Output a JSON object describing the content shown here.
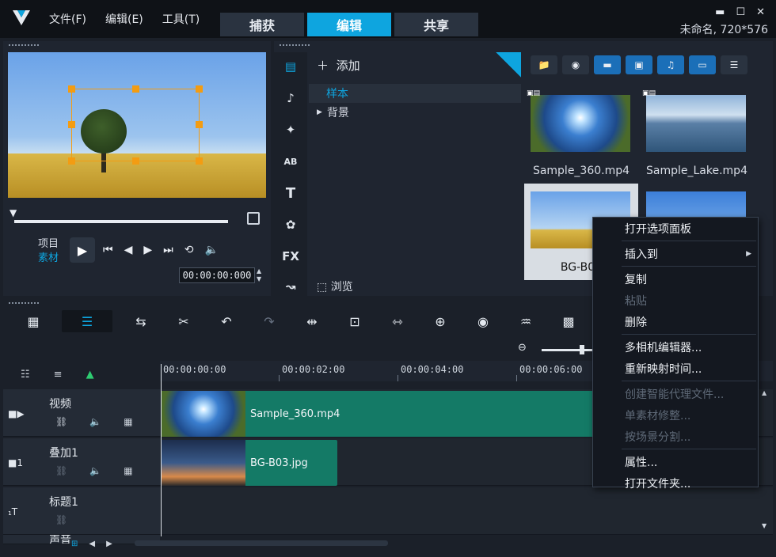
{
  "menu": {
    "file": "文件(F)",
    "edit": "编辑(E)",
    "tools": "工具(T)"
  },
  "stage_tabs": [
    {
      "label": "捕获",
      "active": false
    },
    {
      "label": "编辑",
      "active": true
    },
    {
      "label": "共享",
      "active": false
    }
  ],
  "window": {
    "project_info": "未命名, 720*576",
    "minimize": "▬",
    "maximize": "☐",
    "close": "✕"
  },
  "preview": {
    "mode_project": "项目",
    "mode_clip": "素材",
    "timecode": "00:00:00:000"
  },
  "library": {
    "add_label": "添加",
    "folders": [
      {
        "label": "样本",
        "selected": true,
        "expandable": false
      },
      {
        "label": "背景",
        "selected": false,
        "expandable": true
      }
    ],
    "browse_label": "浏览",
    "thumbnails": [
      {
        "name": "Sample_360.mp4",
        "selected": false
      },
      {
        "name": "Sample_Lake.mp4",
        "selected": false
      },
      {
        "name": "BG-B01",
        "selected": true
      },
      {
        "name": "",
        "selected": false
      }
    ]
  },
  "rail": {
    "fx": "FX",
    "text": "T",
    "ab": "AB"
  },
  "timeline": {
    "ruler": [
      "00:00:00:00",
      "00:00:02:00",
      "00:00:04:00",
      "00:00:06:00"
    ],
    "tracks": [
      {
        "name": "视频",
        "clip": "Sample_360.mp4"
      },
      {
        "name": "叠加1",
        "clip": "BG-B03.jpg"
      },
      {
        "name": "标题1",
        "clip": ""
      },
      {
        "name": "声音",
        "clip": ""
      }
    ]
  },
  "context_menu": {
    "items": [
      {
        "label": "打开选项面板",
        "disabled": false,
        "submenu": false,
        "sep_after": true
      },
      {
        "label": "插入到",
        "disabled": false,
        "submenu": true,
        "sep_after": true
      },
      {
        "label": "复制",
        "disabled": false,
        "submenu": false,
        "sep_after": false
      },
      {
        "label": "粘贴",
        "disabled": true,
        "submenu": false,
        "sep_after": false
      },
      {
        "label": "删除",
        "disabled": false,
        "submenu": false,
        "sep_after": true
      },
      {
        "label": "多相机编辑器...",
        "disabled": false,
        "submenu": false,
        "sep_after": false
      },
      {
        "label": "重新映射时间...",
        "disabled": false,
        "submenu": false,
        "sep_after": true
      },
      {
        "label": "创建智能代理文件...",
        "disabled": true,
        "submenu": false,
        "sep_after": false
      },
      {
        "label": "单素材修整...",
        "disabled": true,
        "submenu": false,
        "sep_after": false
      },
      {
        "label": "按场景分割...",
        "disabled": true,
        "submenu": false,
        "sep_after": true
      },
      {
        "label": "属性...",
        "disabled": false,
        "submenu": false,
        "sep_after": false
      },
      {
        "label": "打开文件夹...",
        "disabled": false,
        "submenu": false,
        "sep_after": false
      }
    ]
  },
  "colors": {
    "accent": "#0ea5df",
    "clip": "#147a66",
    "selection_handle": "#f39c12"
  }
}
